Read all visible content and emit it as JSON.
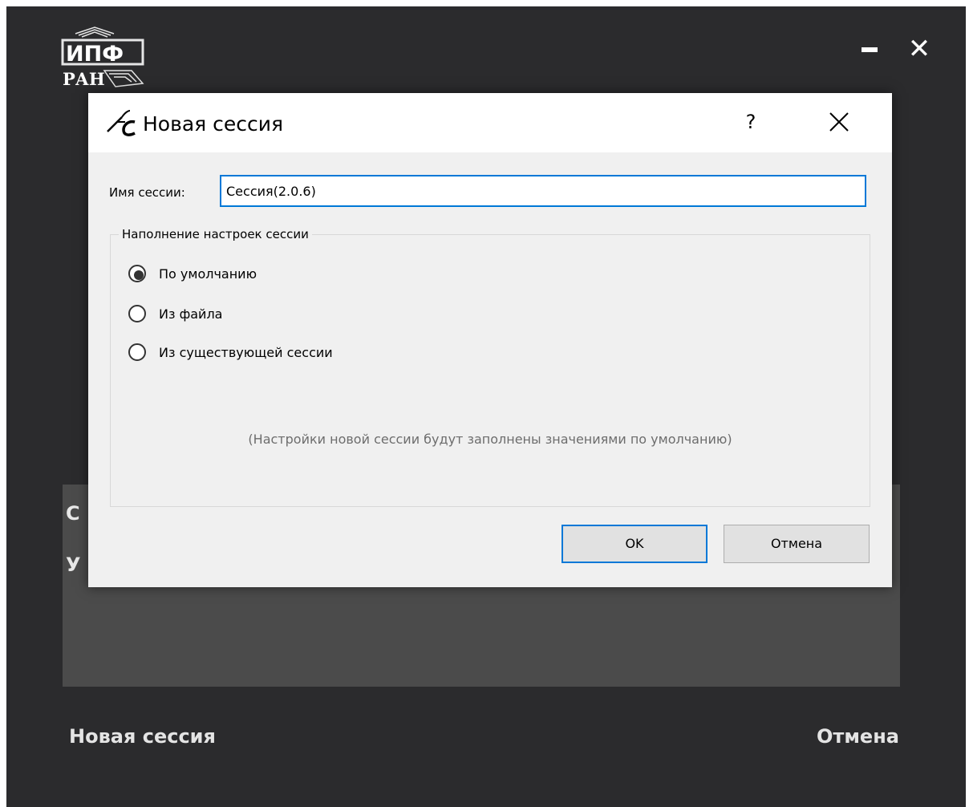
{
  "app": {
    "logo_alt": "ИПФ РАН",
    "window_controls": {
      "minimize_icon": "minimize-icon",
      "close_icon": "close-icon",
      "close_glyph": "✕"
    },
    "background_panel": {
      "line1_visible_char": "С",
      "line2_visible_char": "У"
    },
    "footer": {
      "new_session_label": "Новая сессия",
      "cancel_label": "Отмена"
    }
  },
  "dialog": {
    "title": "Новая сессия",
    "icon": "app-feather-icon",
    "help_label": "?",
    "close_icon": "close-icon",
    "session_name_label": "Имя сессии:",
    "session_name_value": "Сессия(2.0.6)",
    "group_title": "Наполнение настроек сессии",
    "options": [
      {
        "label": "По умолчанию",
        "selected": true
      },
      {
        "label": "Из файла",
        "selected": false
      },
      {
        "label": "Из существующей сессии",
        "selected": false
      }
    ],
    "hint": "(Настройки новой сессии будут заполнены значениями по умолчанию)",
    "ok_label": "OK",
    "cancel_label": "Отмена"
  },
  "colors": {
    "app_background": "#2b2b2d",
    "panel_background": "#4b4b4b",
    "dialog_background": "#f0f0f0",
    "accent": "#0078d7",
    "hint_text": "#6d6d6d"
  }
}
